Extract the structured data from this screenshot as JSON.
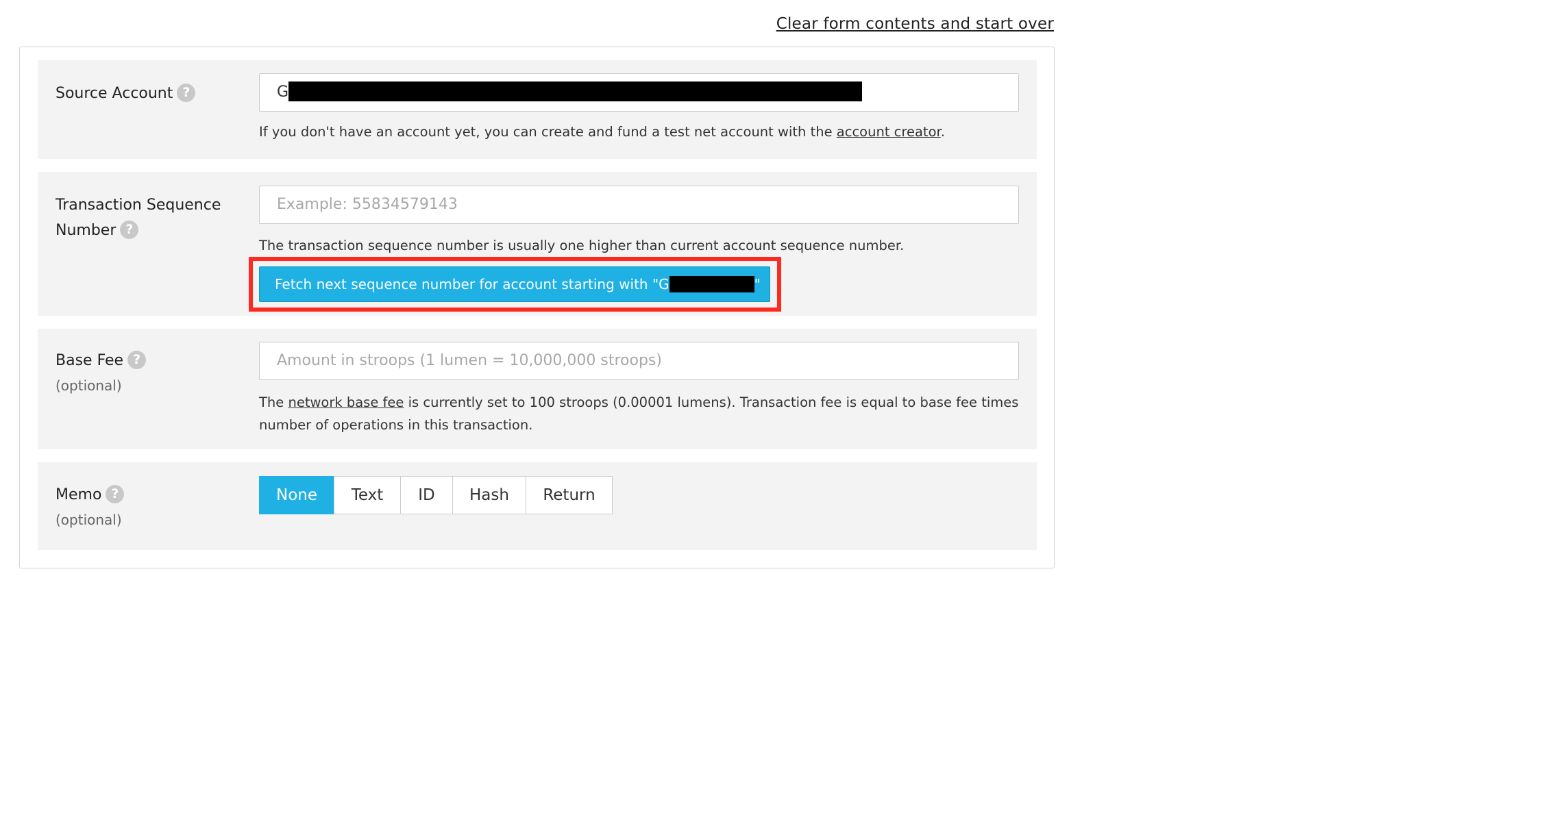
{
  "header": {
    "clear_link": "Clear form contents and start over"
  },
  "source_account": {
    "label": "Source Account",
    "value_prefix": "G",
    "hint_text": "If you don't have an account yet, you can create and fund a test net account with the ",
    "hint_link": "account creator",
    "hint_end": "."
  },
  "sequence": {
    "label_line1": "Transaction Sequence",
    "label_line2": "Number",
    "placeholder": "Example: 55834579143",
    "hint": "The transaction sequence number is usually one higher than current account sequence number.",
    "fetch_button_prefix": "Fetch next sequence number for account starting with \"G",
    "fetch_button_suffix": "\""
  },
  "base_fee": {
    "label": "Base Fee",
    "optional": "(optional)",
    "placeholder": "Amount in stroops (1 lumen = 10,000,000 stroops)",
    "hint_pre": "The ",
    "hint_link": "network base fee",
    "hint_post": " is currently set to 100 stroops (0.00001 lumens). Transaction fee is equal to base fee times number of operations in this transaction."
  },
  "memo": {
    "label": "Memo",
    "optional": "(optional)",
    "options": [
      "None",
      "Text",
      "ID",
      "Hash",
      "Return"
    ],
    "selected": "None"
  },
  "help_icon": "?",
  "colors": {
    "accent": "#1fb0e4",
    "highlight": "#ff2a1f",
    "row_bg": "#f3f3f3"
  }
}
